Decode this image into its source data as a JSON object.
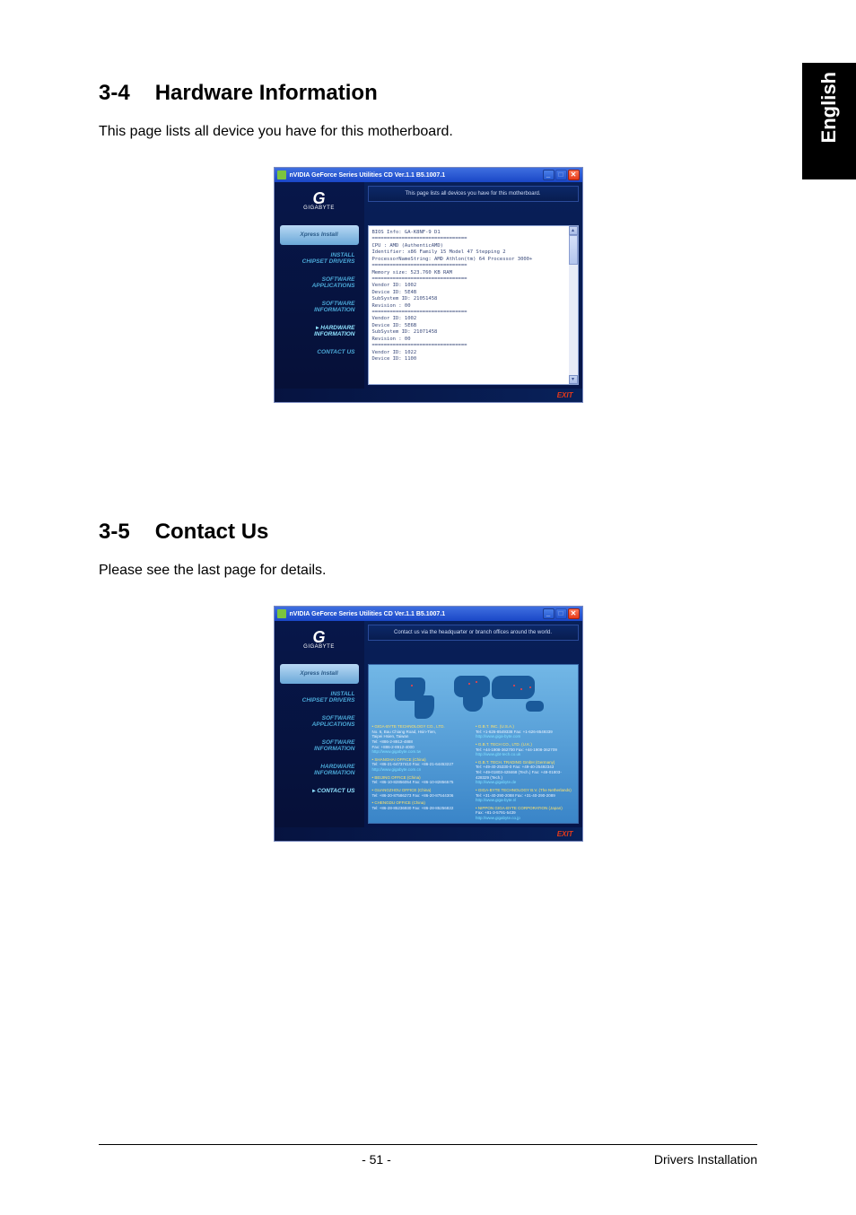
{
  "language_tab": "English",
  "sections": {
    "hw": {
      "number": "3-4",
      "title": "Hardware Information",
      "description": "This page lists all device you have for this motherboard."
    },
    "contact": {
      "number": "3-5",
      "title": "Contact Us",
      "description": "Please see the last page for details."
    }
  },
  "app_window": {
    "title": "nVIDIA GeForce Series Utilities CD Ver.1.1 B5.1007.1",
    "logo_text": "GIGABYTE",
    "exit_label": "EXIT",
    "nav": {
      "xpress": "Xpress Install",
      "install_drivers_l1": "INSTALL",
      "install_drivers_l2": "CHIPSET DRIVERS",
      "sw_apps_l1": "SOFTWARE",
      "sw_apps_l2": "APPLICATIONS",
      "sw_info_l1": "SOFTWARE",
      "sw_info_l2": "INFORMATION",
      "hw_info_l1": "HARDWARE",
      "hw_info_l2": "INFORMATION",
      "contact_us": "CONTACT US"
    }
  },
  "hw_panel": {
    "banner": "This page lists all devices you have for this motherboard.",
    "lines": "BIOS Info: GA-K8NF-9 D1\n================================\nCPU : AMD (AuthenticAMD)\nIdentifier: x86 Family 15 Model 47 Stepping 2\nProcessorNameString: AMD Athlon(tm) 64 Processor 3000+\n================================\nMemory size: 523.760 KB RAM\n================================\nVendor ID: 1002\nDevice ID: 5E4B\nSubSystem ID: 21051458\nRevision : 00\n================================\nVendor ID: 1002\nDevice ID: 5E6B\nSubSystem ID: 21071458\nRevision : 00\n================================\nVendor ID: 1022\nDevice ID: 1100"
  },
  "contact_panel": {
    "banner": "Contact us via the headquarter or branch offices around the world.",
    "left": [
      {
        "hd": "• GIGA-BYTE TECHNOLOGY CO., LTD.",
        "body": "No. 6, Bau Chiang Road, Hsin-Tien,\nTaipei Hsien, Taiwan\nTel: +886-2-8912-4888\nFax: +886-2-8912-4000",
        "url": "http://www.gigabyte.com.tw"
      },
      {
        "hd": "• SHANGHAI OFFICE (China)",
        "body": "Tel: +86-21-64737410  Fax: +86-21-64453227",
        "url": "http://www.gigabyte.com.cn"
      },
      {
        "hd": "• BEIJING OFFICE (China)",
        "body": "Tel: +86-10-82856054  Fax: +86-10-82856575",
        "url": ""
      },
      {
        "hd": "• GUANGZHOU OFFICE (China)",
        "body": "Tel: +86-20-87586273  Fax: +86-20-87544306",
        "url": ""
      },
      {
        "hd": "• CHENGDU OFFICE (China)",
        "body": "Tel: +86-28-85236930  Fax: +86-28-85256822",
        "url": ""
      }
    ],
    "right": [
      {
        "hd": "• G.B.T. INC. (U.S.A.)",
        "body": "Tel: +1-626-8549338  Fax: +1-626-8549339",
        "url": "http://www.giga-byte.com"
      },
      {
        "hd": "• G.B.T. TECH CO., LTD. (U.K.)",
        "body": "Tel: +44-1908-362700  Fax: +44-1908-362709",
        "url": "http://www.gbt-tech.co.uk"
      },
      {
        "hd": "• G.B.T. TECH. TRADING GmbH (Germany)",
        "body": "Tel: +49-40-25330-0  Fax: +49-40-25492343\nTel: +49-01803-428468 (Tech.)  Fax: +49-01803-428329 (Tech.)",
        "url": "http://www.gigabyte.de"
      },
      {
        "hd": "• GIGA-BYTE TECHNOLOGY B.V. (The Netherlands)",
        "body": "Tel: +31-40-290-2088  Fax: +31-40-290-2089",
        "url": "http://www.giga-byte.nl"
      },
      {
        "hd": "• NIPPON GIGA-BYTE CORPORATION (Japan)",
        "body": "Fax: +81-3-5791-5439",
        "url": "http://www.gigabyte.co.jp"
      }
    ]
  },
  "footer": {
    "page_number": "- 51 -",
    "section_name": "Drivers Installation"
  }
}
